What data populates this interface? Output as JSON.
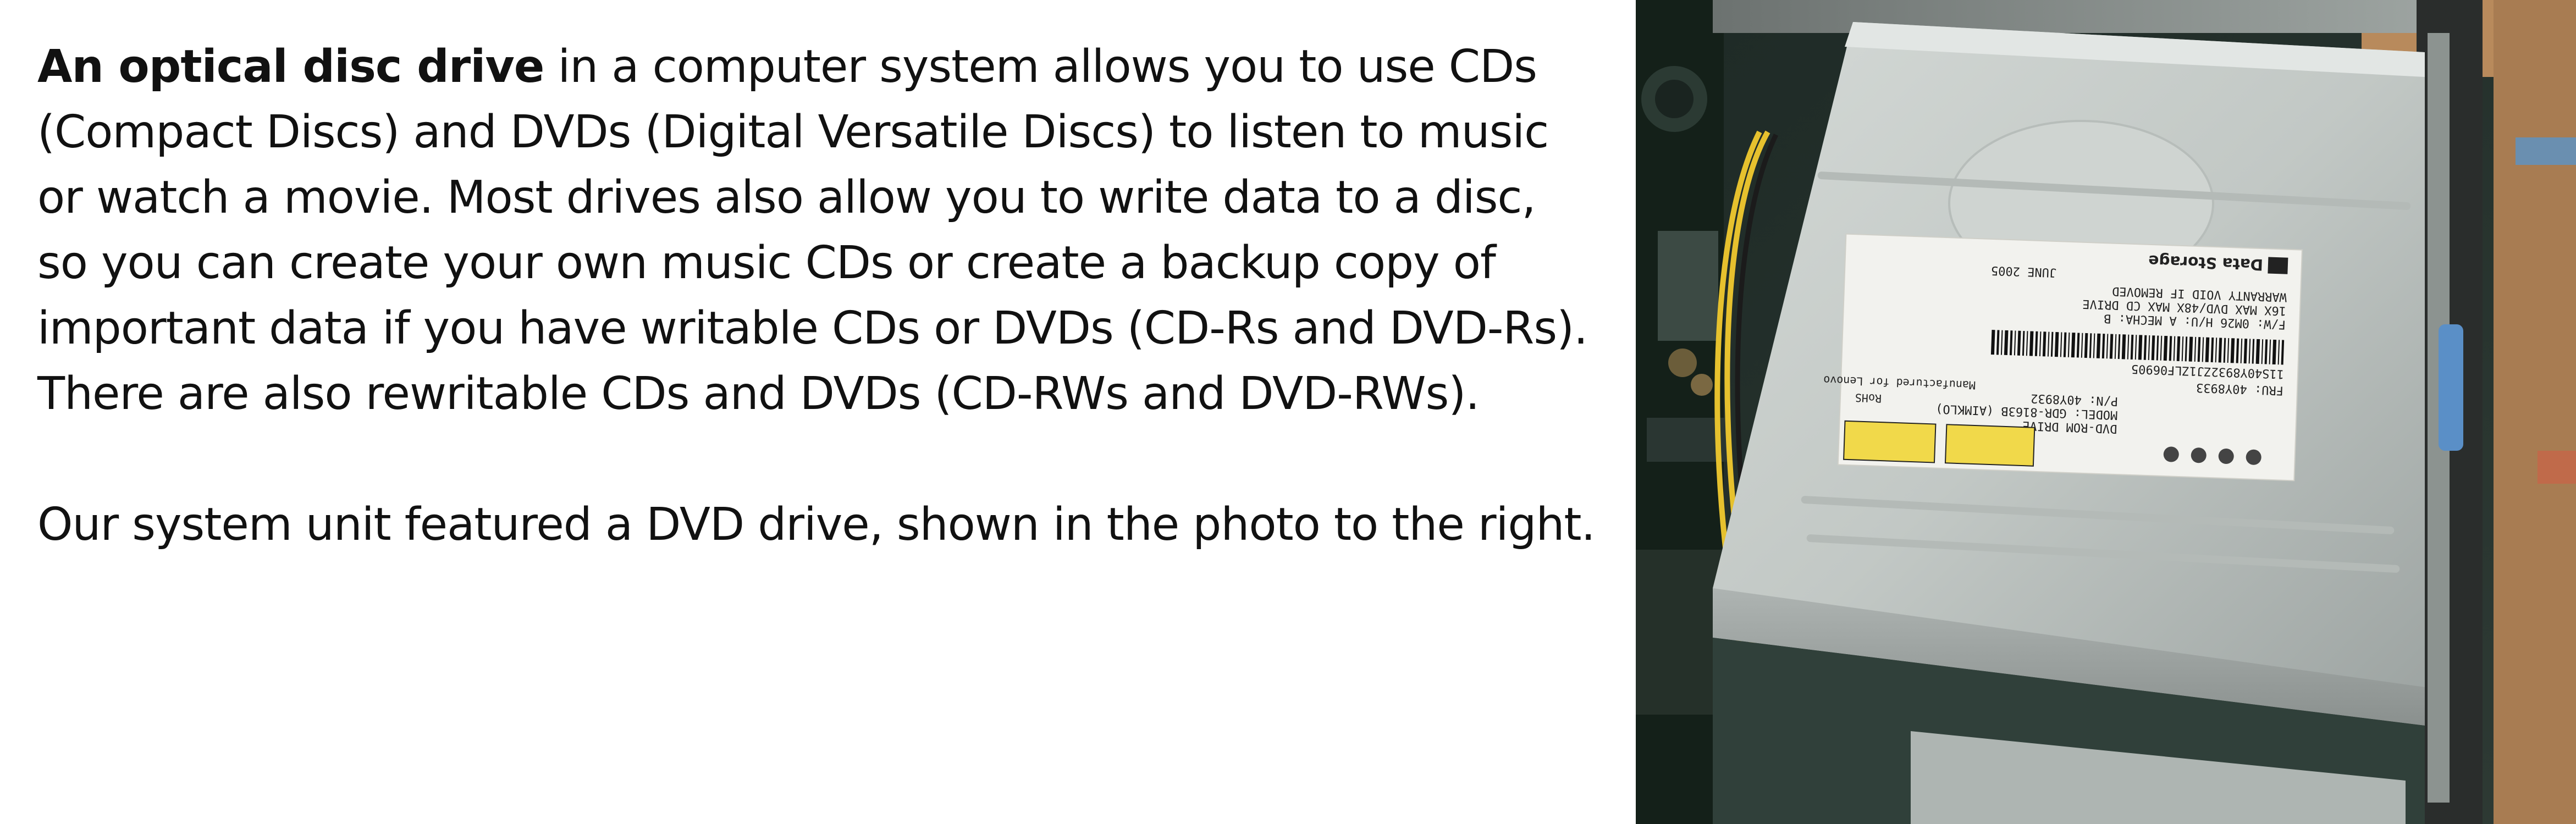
{
  "paragraph1": {
    "bold_lead": "An optical disc drive",
    "rest": " in a computer system allows you to use CDs (Compact Discs) and DVDs (Digital Versatile Discs) to listen to music or watch a movie. Most drives also allow you to write data to a disc, so you can create your own music CDs or create a backup copy of important data if you have writable CDs or DVDs (CD-Rs and DVD-Rs). There are also rewritable CDs and DVDs (CD-RWs and DVD-RWs)."
  },
  "paragraph2": "Our system unit featured a DVD drive, shown in the photo to the right.",
  "photo": {
    "brand": "Data Storage",
    "model_line": "DVD-ROM DRIVE",
    "model": "MODEL: GDR-8163B (AIMKLO)",
    "part_number": "P/N: 40Y8932",
    "fru": "FRU: 40Y8933",
    "barcode_text": "11S40Y8932ZJ1ZLF06905",
    "spec": "16X MAX DVD/48X MAX CD DRIVE",
    "warranty": "WARRANTY VOID IF REMOVED",
    "fw": "F/W: 0M26 H/U: A MECHA: B",
    "date": "JUNE 2005",
    "manufactured": "Manufactured for Lenovo",
    "rohs": "RoHS"
  }
}
